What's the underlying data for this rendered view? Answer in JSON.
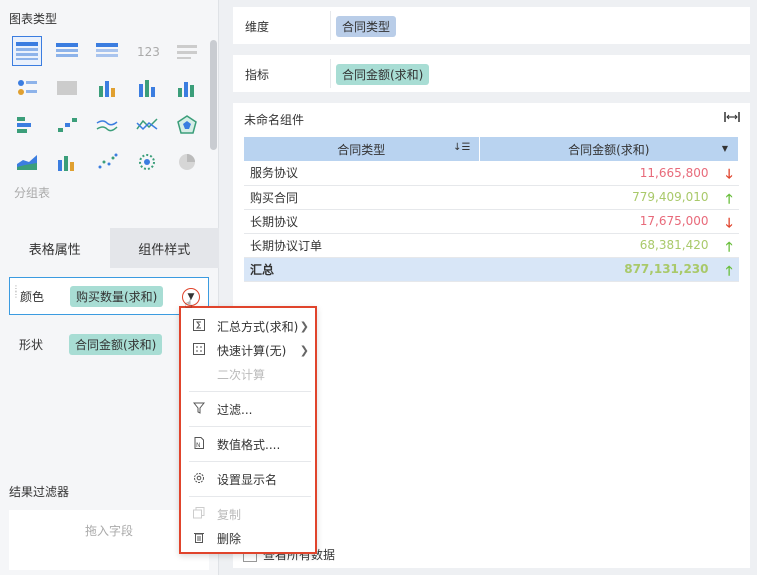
{
  "left_panel": {
    "chart_type_title": "图表类型",
    "group_label": "分组表",
    "tabs": [
      {
        "label": "表格属性",
        "active": true
      },
      {
        "label": "组件样式",
        "active": false
      }
    ],
    "properties": [
      {
        "label": "颜色",
        "field": "购买数量(求和)",
        "active": true
      },
      {
        "label": "形状",
        "field": "合同金额(求和)",
        "active": false
      }
    ],
    "filter_title": "结果过滤器",
    "filter_placeholder": "拖入字段"
  },
  "dimension": {
    "label": "维度",
    "field": "合同类型"
  },
  "metric": {
    "label": "指标",
    "field": "合同金额(求和)"
  },
  "widget": {
    "title": "未命名组件",
    "columns": [
      "合同类型",
      "合同金额(求和)"
    ],
    "rows": [
      {
        "name": "服务协议",
        "value": "11,665,800",
        "trend": "down"
      },
      {
        "name": "购买合同",
        "value": "779,409,010",
        "trend": "up"
      },
      {
        "name": "长期协议",
        "value": "17,675,000",
        "trend": "down"
      },
      {
        "name": "长期协议订单",
        "value": "68,381,420",
        "trend": "up"
      }
    ],
    "total": {
      "name": "汇总",
      "value": "877,131,230",
      "trend": "up"
    },
    "view_all_label": "查看所有数据"
  },
  "context_menu": {
    "items": [
      {
        "label": "汇总方式(求和)",
        "icon": "sum-icon",
        "submenu": true,
        "disabled": false
      },
      {
        "label": "快速计算(无)",
        "icon": "calc-icon",
        "submenu": true,
        "disabled": false
      },
      {
        "label": "二次计算",
        "icon": "",
        "submenu": false,
        "disabled": true
      },
      {
        "label": "过滤...",
        "icon": "filter-icon",
        "submenu": false,
        "disabled": false
      },
      {
        "label": "数值格式....",
        "icon": "number-format-icon",
        "submenu": false,
        "disabled": false
      },
      {
        "label": "设置显示名",
        "icon": "gear-icon",
        "submenu": false,
        "disabled": false
      },
      {
        "label": "复制",
        "icon": "copy-icon",
        "submenu": false,
        "disabled": true
      },
      {
        "label": "删除",
        "icon": "trash-icon",
        "submenu": false,
        "disabled": false
      }
    ]
  },
  "colors": {
    "accent": "#3b7de0",
    "down": "#e0442c",
    "up": "#6bbf3e",
    "down_value": "#e86a7a",
    "up_value": "#a9c96a",
    "highlight_border": "#e0442c"
  }
}
